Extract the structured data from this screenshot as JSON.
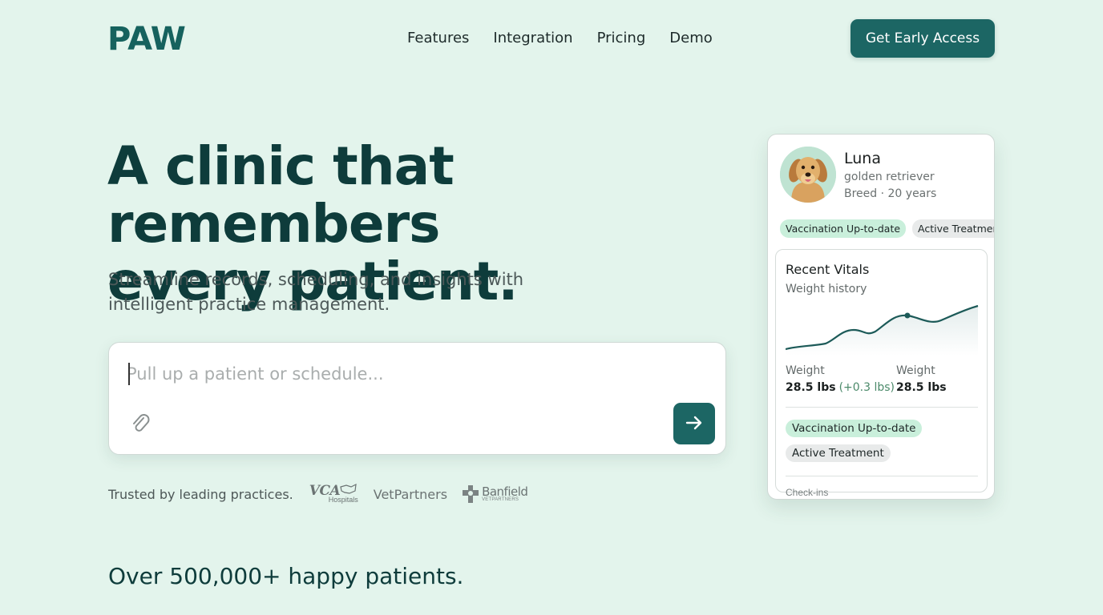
{
  "header": {
    "logo": "PAW",
    "nav": [
      "Features",
      "Integration",
      "Pricing",
      "Demo"
    ],
    "cta_label": "Get Early Access"
  },
  "hero": {
    "headline_line1": "A clinic that remembers",
    "headline_line2": "every patient.",
    "subhead": "Streamline records, scheduling, and insights with intelligent practice management."
  },
  "search": {
    "placeholder": "Pull up a patient or schedule..."
  },
  "trusted": {
    "label": "Trusted by leading practices.",
    "logos": {
      "vca": "VCA",
      "vca_sub": "Hospitals",
      "vetpartners": "VetPartners",
      "banfield": "Banfield",
      "banfield_sub": "VETPARTNERS"
    }
  },
  "stats": {
    "happy_patients": "Over 500,000+ happy patients."
  },
  "patient_card": {
    "name": "Luna",
    "breed": "golden retriever",
    "age_line": "Breed · 20 years",
    "tags": [
      "Vaccination Up-to-date",
      "Active Treatment"
    ],
    "vitals": {
      "title": "Recent Vitals",
      "subtitle": "Weight history",
      "weight_label_1": "Weight",
      "weight_value_1": "28.5 lbs",
      "weight_delta": "(+0.3 lbs)",
      "weight_label_2": "Weight",
      "weight_value_2": "28.5 lbs",
      "status_tags": [
        "Vaccination Up-to-date",
        "Active Treatment"
      ],
      "cut_text": "Check-ins"
    }
  },
  "colors": {
    "background": "#e3f4ec",
    "brand": "#1c6664",
    "heading": "#0e3c3b",
    "tag_green": "#c9efdb",
    "tag_grey": "#e8eaea"
  },
  "icons": {
    "attach": "paperclip-icon",
    "submit": "arrow-right-icon"
  }
}
